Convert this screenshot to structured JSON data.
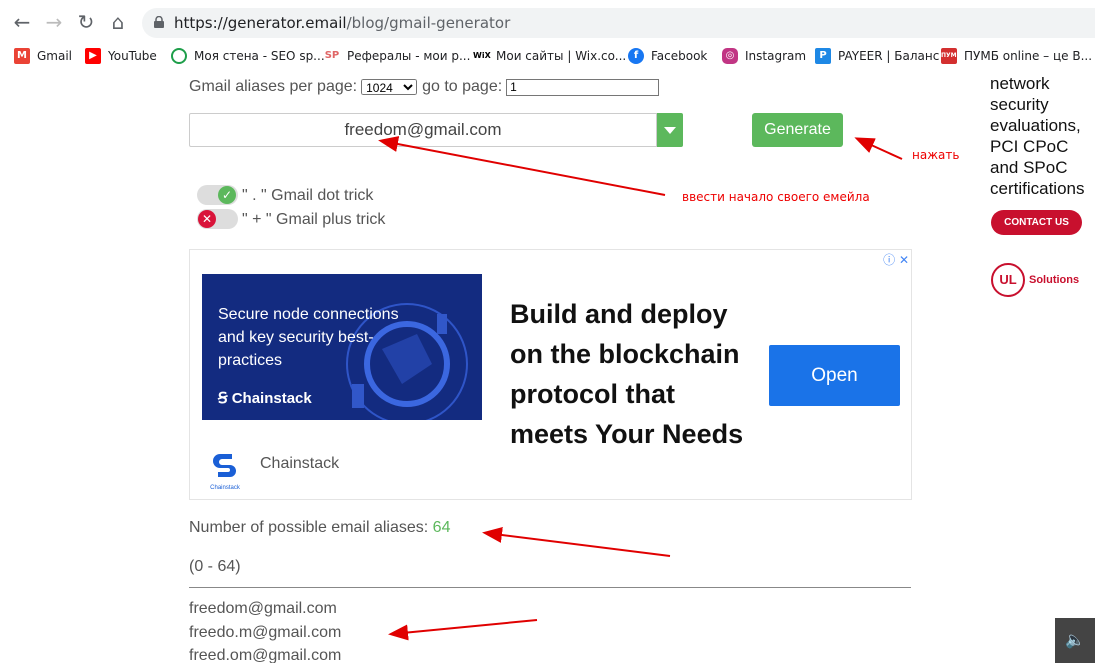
{
  "browser": {
    "url_host": "https://generator.email",
    "url_path": "/blog/gmail-generator"
  },
  "bookmarks": [
    {
      "label": "Gmail",
      "icon": "gmail-icon",
      "color": "#ea4335"
    },
    {
      "label": "YouTube",
      "icon": "youtube-icon",
      "color": "#ff0000"
    },
    {
      "label": "Моя стена - SEO sp...",
      "icon": "seosprint-icon",
      "color": "#1e9e4a"
    },
    {
      "label": "Рефералы - мои р...",
      "icon": "sp-icon",
      "color": "#e06666"
    },
    {
      "label": "Мои сайты | Wix.co...",
      "icon": "wix-icon",
      "color": "#000000"
    },
    {
      "label": "Facebook",
      "icon": "facebook-icon",
      "color": "#1877f2"
    },
    {
      "label": "Instagram",
      "icon": "instagram-icon",
      "color": "#c13584"
    },
    {
      "label": "PAYEER | Баланс",
      "icon": "payeer-icon",
      "color": "#1e88e5"
    },
    {
      "label": "ПУМБ online – це В...",
      "icon": "pumb-icon",
      "color": "#d32f2f"
    }
  ],
  "controls": {
    "per_page_label": "Gmail aliases per page:",
    "per_page_value": "1024",
    "goto_label": "go to page:",
    "goto_value": "1",
    "email_value": "freedom@gmail.com",
    "generate_label": "Generate",
    "dot_trick_label": "\" . \" Gmail dot trick",
    "dot_trick_on": true,
    "plus_trick_label": "\" + \" Gmail plus trick",
    "plus_trick_on": false
  },
  "ad": {
    "image_text": "Secure node connections and key security best-practices",
    "image_brand": "Chainstack",
    "headline": "Build and deploy on the blockchain protocol that meets Your Needs",
    "cta": "Open",
    "brand": "Chainstack",
    "logo_caption": "Chainstack"
  },
  "results": {
    "count_label": "Number of possible email aliases:",
    "count_value": "64",
    "range": "(0 - 64)",
    "aliases": [
      "freedom@gmail.com",
      "freedo.m@gmail.com",
      "freed.om@gmail.com"
    ]
  },
  "side_ad": {
    "text_lines": [
      "network",
      "security",
      "evaluations,",
      "PCI CPoC",
      "and SPoC",
      "certifications"
    ],
    "cta": "CONTACT US",
    "logo_mark": "UL",
    "logo_text": "Solutions"
  },
  "annotations": {
    "press": "нажать",
    "enter_email": "ввести начало своего емейла"
  },
  "colors": {
    "accent_green": "#5cb85c",
    "annotation_red": "#e00000",
    "ad_blue": "#1a73e8"
  }
}
